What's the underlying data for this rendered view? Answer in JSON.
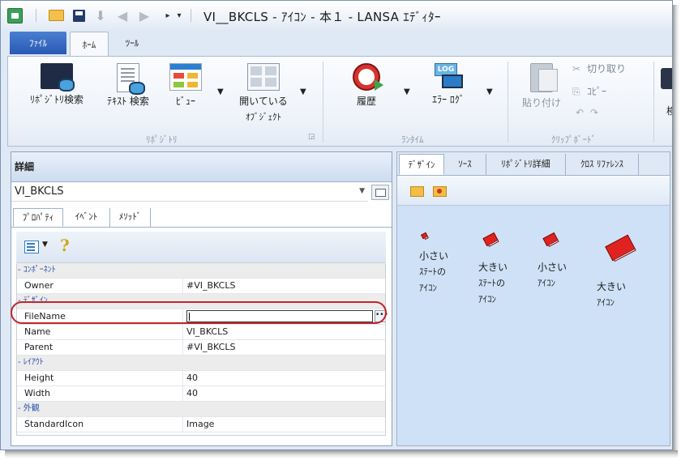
{
  "window": {
    "title": "VI__BKCLS - ｱｲｺﾝ - 本１ - LANSA ｴﾃﾞｨﾀｰ"
  },
  "ribbon": {
    "tabs": [
      "ﾌｧｲﾙ",
      "ﾎｰﾑ",
      "ﾂｰﾙ"
    ],
    "buttons": {
      "repo_search": "ﾘﾎﾟｼﾞﾄﾘ検索",
      "text_search": "ﾃｷｽﾄ 検索",
      "view": "ﾋﾞｭｰ",
      "open_objects_1": "開いている",
      "open_objects_2": "ｵﾌﾞｼﾞｪｸﾄ",
      "history": "履歴",
      "error_log": "ｴﾗｰ ﾛｸﾞ",
      "paste": "貼り付け",
      "cut": "切り取り",
      "copy": "ｺﾋﾟｰ",
      "edge_label": "検"
    },
    "groups": {
      "repository": "ﾘﾎﾟｼﾞﾄﾘ",
      "runtime": "ﾗﾝﾀｲﾑ",
      "clipboard": "ｸﾘｯﾌﾟﾎﾞｰﾄﾞ"
    }
  },
  "details_panel": {
    "title": "詳細",
    "object": "VI_BKCLS",
    "tabs": [
      "ﾌﾟﾛﾊﾟﾃｨ",
      "ｲﾍﾞﾝﾄ",
      "ﾒｿｯﾄﾞ"
    ],
    "properties": {
      "cat_component": "- ｺﾝﾎﾟｰﾈﾝﾄ",
      "owner_name": "Owner",
      "owner_value": "#VI_BKCLS",
      "cat_design": "- ﾃﾞｻﾞｲﾝ",
      "filename_name": "FileName",
      "filename_value": "",
      "name_name": "Name",
      "name_value": "VI_BKCLS",
      "parent_name": "Parent",
      "parent_value": "#VI_BKCLS",
      "cat_layout": "- ﾚｲｱｳﾄ",
      "height_name": "Height",
      "height_value": "40",
      "width_name": "Width",
      "width_value": "40",
      "cat_appearance": "- 外観",
      "icon_name": "StandardIcon",
      "icon_value": "Image"
    }
  },
  "design_panel": {
    "tabs": [
      "ﾃﾞｻﾞｲﾝ",
      "ｿｰｽ",
      "ﾘﾎﾟｼﾞﾄﾘ詳細",
      "ｸﾛｽ ﾘﾌｧﾚﾝｽ"
    ],
    "icons": {
      "i1": [
        "小さい",
        "ｽﾃｰﾄの",
        "ｱｲｺﾝ"
      ],
      "i2": [
        "大きい",
        "ｽﾃｰﾄの",
        "ｱｲｺﾝ"
      ],
      "i3": [
        "小さい",
        "ｱｲｺﾝ"
      ],
      "i4": [
        "大きい",
        "ｱｲｺﾝ"
      ]
    }
  },
  "colors": {
    "file_tab": "#2859b5",
    "highlight": "#c0252a",
    "canvas": "#cfe1f7",
    "book": "#e02320"
  }
}
